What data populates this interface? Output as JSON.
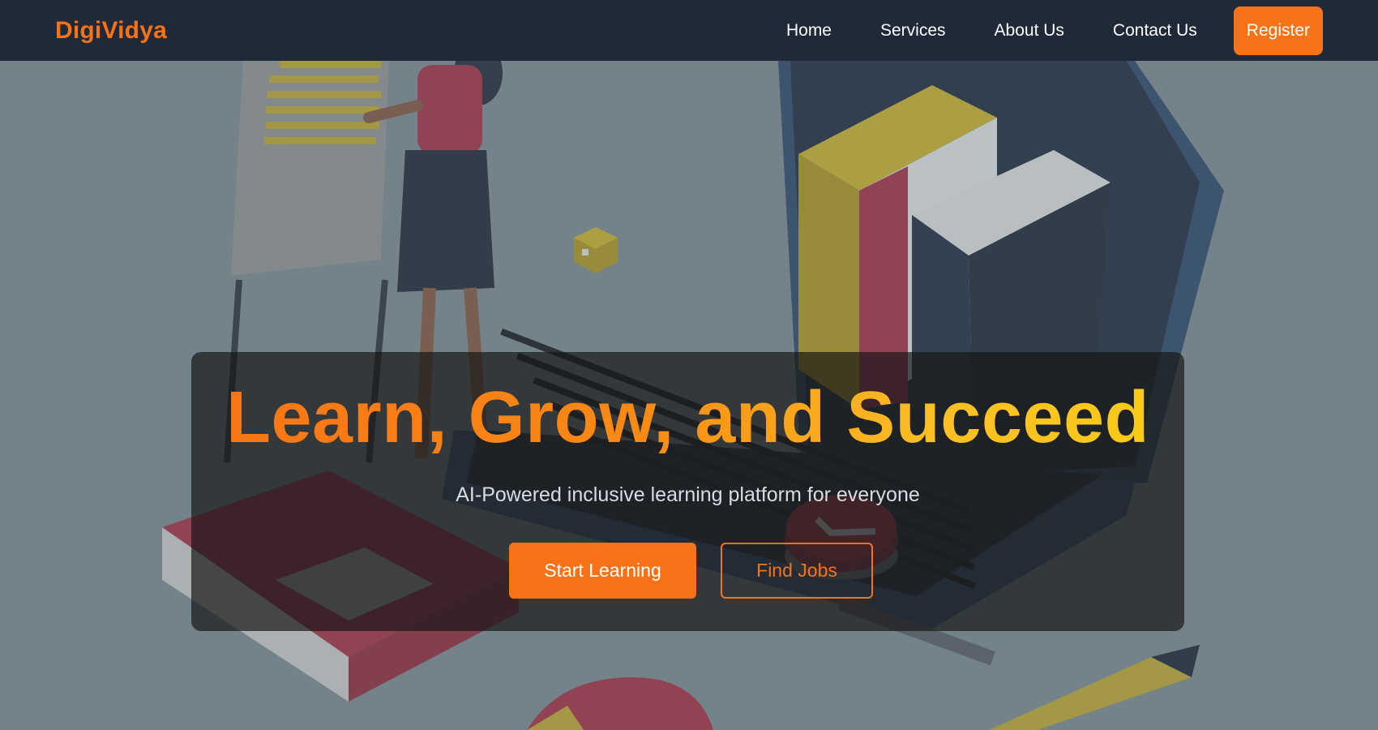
{
  "navbar": {
    "brand": "DigiVidya",
    "links": [
      "Home",
      "Services",
      "About Us",
      "Contact Us"
    ],
    "register_label": "Register"
  },
  "hero": {
    "headline": "Learn, Grow, and Succeed",
    "subtitle": "AI-Powered inclusive learning platform for everyone",
    "primary_cta": "Start Learning",
    "secondary_cta": "Find Jobs"
  },
  "colors": {
    "nav_bg": "#1f2937",
    "accent": "#f97316",
    "headline_gradient_end": "#facc15"
  }
}
